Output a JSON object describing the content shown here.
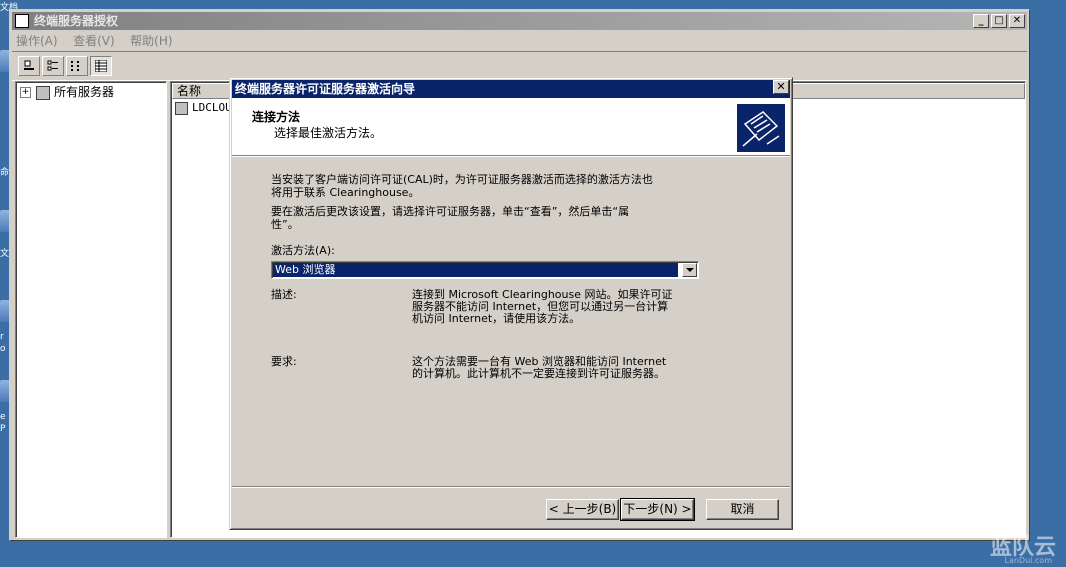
{
  "desktop": {
    "labels": [
      "文档",
      "命",
      "文",
      "r",
      "o",
      "e",
      "P"
    ],
    "watermark": "蓝队云",
    "watermark_sub": "LanDui.com"
  },
  "window": {
    "title": "终端服务器授权",
    "menu": [
      "操作(A)",
      "查看(V)",
      "帮助(H)"
    ],
    "caption_buttons": [
      "minimize",
      "maximize",
      "close"
    ]
  },
  "toolbar": {
    "buttons": [
      "large-icons-icon",
      "small-icons-icon",
      "list-icon",
      "details-icon"
    ]
  },
  "tree": {
    "root_label": "所有服务器",
    "expander": "+"
  },
  "list": {
    "columns": [
      "名称"
    ],
    "rows": [
      "LDCLOU"
    ]
  },
  "dialog": {
    "title": "终端服务器许可证服务器激活向导",
    "header_title": "连接方法",
    "header_subtitle": "选择最佳激活方法。",
    "intro_1a": "当安装了客户端访问许可证(CAL)时，为许可证服务器激活而选择的激活方法也",
    "intro_1b": "将用于联系 Clearinghouse。",
    "intro_2a": "要在激活后更改该设置，请选择许可证服务器，单击“查看”，然后单击“属",
    "intro_2b": "性”。",
    "method_label": "激活方法(A):",
    "method_value": "Web 浏览器",
    "desc_label": "描述:",
    "desc_a": "连接到 Microsoft Clearinghouse 网站。如果许可证",
    "desc_b": "服务器不能访问 Internet，但您可以通过另一台计算",
    "desc_c": "机访问 Internet，请使用该方法。",
    "req_label": "要求:",
    "req_a": "这个方法需要一台有 Web 浏览器和能访问 Internet",
    "req_b": "的计算机。此计算机不一定要连接到许可证服务器。",
    "back_button": "< 上一步(B)",
    "next_button": "下一步(N) >",
    "cancel_button": "取消",
    "close_glyph": "✕"
  }
}
